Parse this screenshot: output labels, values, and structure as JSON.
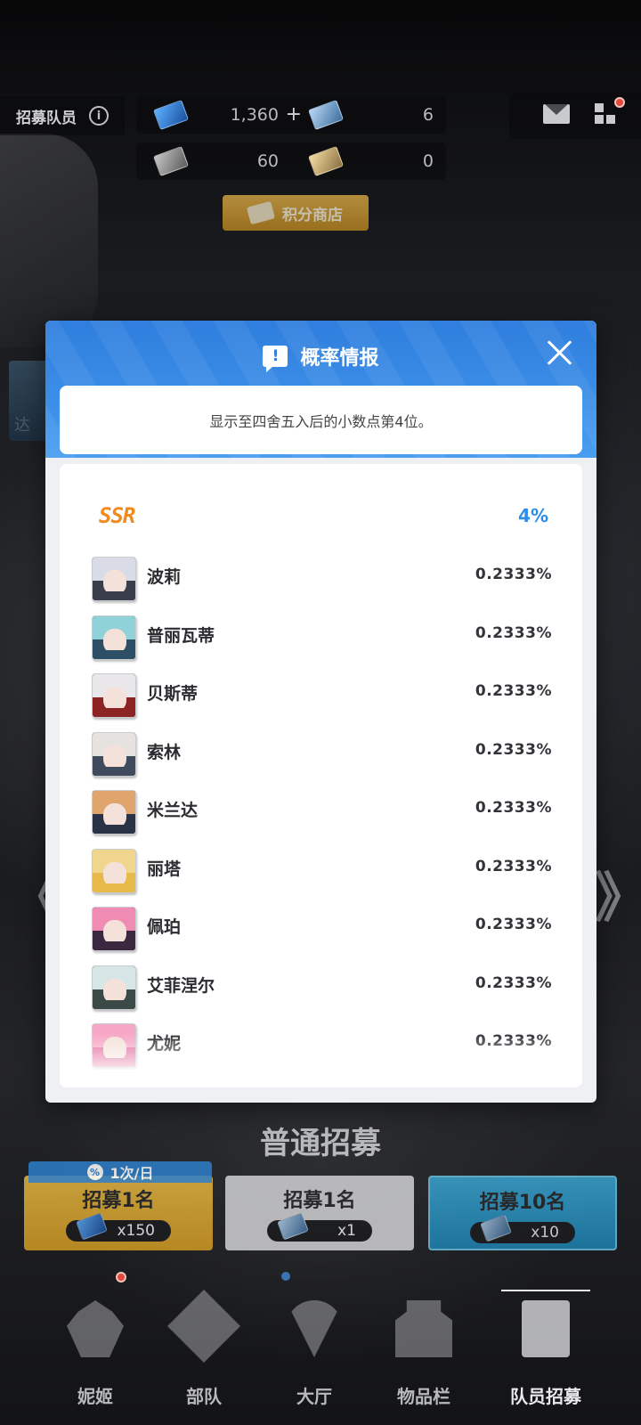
{
  "topbar": {
    "title": "招募队员",
    "info_icon": "i",
    "currencies": [
      {
        "icon": "blue-ticket-icon",
        "value": "1,360",
        "plus": "+"
      },
      {
        "icon": "blue-silver-ticket-icon",
        "value": "6"
      },
      {
        "icon": "grey-ticket-icon",
        "value": "60"
      },
      {
        "icon": "gold-ticket-icon",
        "value": "0"
      }
    ],
    "shop_label": "积分商店"
  },
  "side_banner_text": "达",
  "modal": {
    "title": "概率情报",
    "alert_glyph": "!",
    "notice": "显示至四舍五入后的小数点第4位。",
    "tier": {
      "label": "SSR",
      "percent": "4%"
    },
    "rows": [
      {
        "name": "波莉",
        "rate": "0.2333%"
      },
      {
        "name": "普丽瓦蒂",
        "rate": "0.2333%"
      },
      {
        "name": "贝斯蒂",
        "rate": "0.2333%"
      },
      {
        "name": "索林",
        "rate": "0.2333%"
      },
      {
        "name": "米兰达",
        "rate": "0.2333%"
      },
      {
        "name": "丽塔",
        "rate": "0.2333%"
      },
      {
        "name": "佩珀",
        "rate": "0.2333%"
      },
      {
        "name": "艾菲涅尔",
        "rate": "0.2333%"
      },
      {
        "name": "尤妮",
        "rate": "0.2333%"
      }
    ]
  },
  "recruit": {
    "section_title": "普通招募",
    "daily_tag": "1次/日",
    "buttons": [
      {
        "title": "招募1名",
        "cost": "x150"
      },
      {
        "title": "招募1名",
        "cost": "x1"
      },
      {
        "title": "招募10名",
        "cost": "x10"
      }
    ]
  },
  "nav": {
    "items": [
      {
        "label": "妮姬",
        "icon": "nikke-icon"
      },
      {
        "label": "部队",
        "icon": "squad-icon"
      },
      {
        "label": "大厅",
        "icon": "lobby-icon"
      },
      {
        "label": "物品栏",
        "icon": "inventory-icon"
      },
      {
        "label": "队员招募",
        "icon": "recruit-icon"
      }
    ],
    "active": "队员招募"
  },
  "arrows": {
    "left": "《",
    "right": "》"
  },
  "colors": {
    "accent": "#2f7ede",
    "ssr": "#f08a1e",
    "percent_blue": "#2a8ee8"
  }
}
